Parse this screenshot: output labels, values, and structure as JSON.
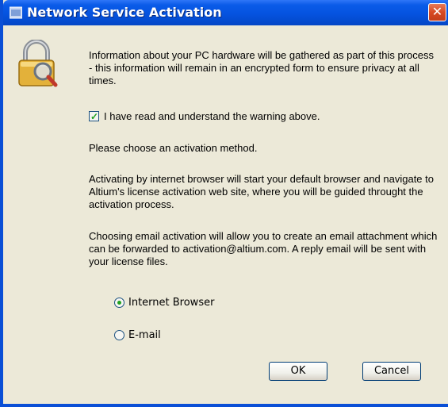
{
  "window": {
    "title": "Network Service Activation",
    "close_icon": "close-icon",
    "app_icon": "dxp-app-icon"
  },
  "content": {
    "icon": "lock-magnifier-icon",
    "warning_text": "Information about your PC hardware will be gathered as part of this process - this information will remain in an encrypted form to ensure privacy at all times.",
    "acknowledge": {
      "label": "I have read and understand the warning above.",
      "checked": true
    },
    "choose_text": "Please choose an activation method.",
    "browser_info": "Activating by internet browser will start your default browser and navigate to Altium's license activation web site, where you will be guided throught the activation process.",
    "email_info": "Choosing email activation will allow you to create an email attachment which can be forwarded to activation@altium.com. A reply email will be sent with your license files.",
    "methods": [
      {
        "label": "Internet Browser",
        "selected": true
      },
      {
        "label": "E-mail",
        "selected": false
      }
    ]
  },
  "buttons": {
    "ok": "OK",
    "cancel": "Cancel"
  },
  "colors": {
    "titlebar": "#0553e0",
    "background": "#ece9d8",
    "accent_green": "#21a121"
  }
}
